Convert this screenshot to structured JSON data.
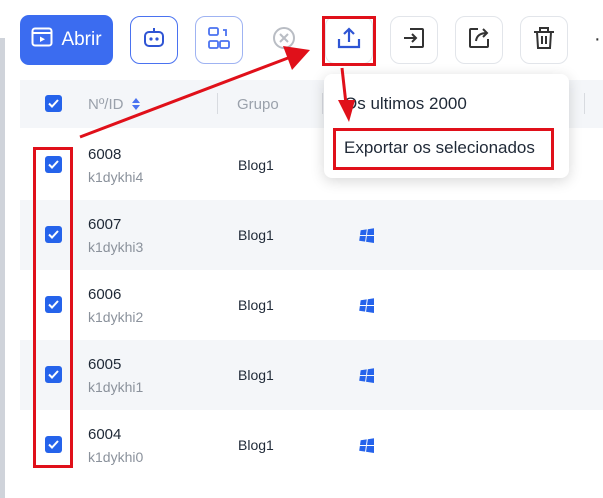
{
  "toolbar": {
    "open_label": "Abrir",
    "more_label": "·"
  },
  "table": {
    "headers": {
      "id": "Nº/ID",
      "group": "Grupo"
    },
    "rows": [
      {
        "id": "6008",
        "name": "k1dykhi4",
        "group": "Blog1",
        "checked": true
      },
      {
        "id": "6007",
        "name": "k1dykhi3",
        "group": "Blog1",
        "checked": true
      },
      {
        "id": "6006",
        "name": "k1dykhi2",
        "group": "Blog1",
        "checked": true
      },
      {
        "id": "6005",
        "name": "k1dykhi1",
        "group": "Blog1",
        "checked": true
      },
      {
        "id": "6004",
        "name": "k1dykhi0",
        "group": "Blog1",
        "checked": true
      }
    ]
  },
  "export_menu": {
    "items": [
      {
        "label": "Os ultimos 2000"
      },
      {
        "label": "Exportar os selecionados"
      }
    ]
  },
  "colors": {
    "primary": "#3b6cf0",
    "checkbox": "#2563eb",
    "annotation": "#e0101a",
    "row_alt": "#f4f6f9"
  }
}
